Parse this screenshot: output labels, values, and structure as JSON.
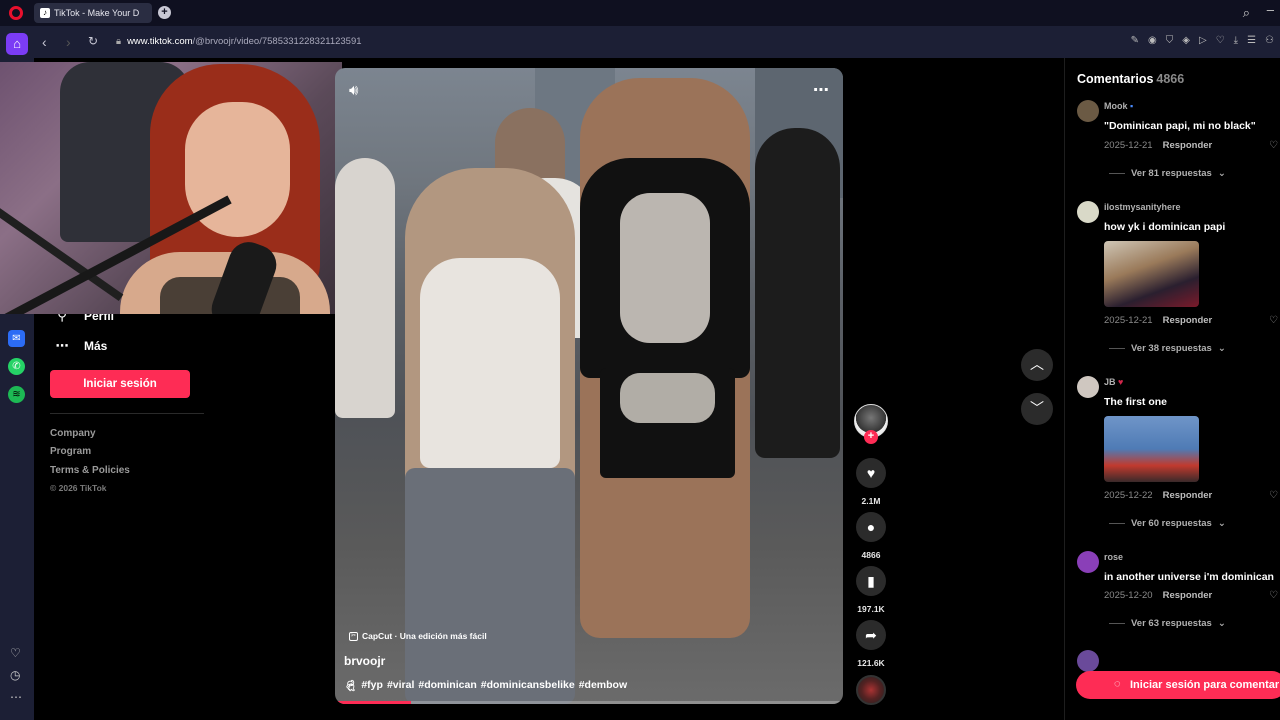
{
  "browser": {
    "tab_title": "TikTok - Make Your D",
    "url_host": "www.tiktok.com",
    "url_path": "/@brvoojr/video/7585331228321123591",
    "new_tab_symbol": "+"
  },
  "nav": {
    "items": [
      {
        "label": "Perfil",
        "icon": "person-icon"
      },
      {
        "label": "Más",
        "icon": "more-icon"
      }
    ],
    "login_label": "Iniciar sesión",
    "footer_links": [
      "Company",
      "Program",
      "Terms & Policies"
    ],
    "copyright": "© 2026 TikTok"
  },
  "video": {
    "capcut_label": "CapCut · Una edición más fácil",
    "author": "brvoojr",
    "tags": [
      "#fyp",
      "#viral",
      "#dominican",
      "#dominicansbelike",
      "#dembow"
    ],
    "progress": 0.15
  },
  "actions": [
    {
      "name": "like",
      "icon": "heart-icon",
      "count": "2.1M"
    },
    {
      "name": "comment",
      "icon": "comment-icon",
      "count": "4866"
    },
    {
      "name": "save",
      "icon": "bookmark-icon",
      "count": "197.1K"
    },
    {
      "name": "share",
      "icon": "share-icon",
      "count": "121.6K"
    }
  ],
  "comments": {
    "title": "Comentarios",
    "count": "4866",
    "reply_label": "Responder",
    "items": [
      {
        "user": "Mook",
        "text": "\"Dominican papi, mi no black\"",
        "date": "2025-12-21",
        "replies": "Ver 81 respuestas"
      },
      {
        "user": "ilostmysanityhere",
        "text": "how yk i dominican papi",
        "date": "2025-12-21",
        "replies": "Ver 38 respuestas"
      },
      {
        "user": "JB",
        "text": "The first one",
        "date": "2025-12-22",
        "replies": "Ver 60 respuestas"
      },
      {
        "user": "rose",
        "text": "in another universe i'm dominican",
        "date": "2025-12-20",
        "replies": "Ver 63 respuestas"
      }
    ],
    "login_label": "Iniciar sesión para comentar"
  },
  "colors": {
    "accent": "#fe2c55",
    "opera_purple": "#7b3cf5",
    "chrome_bg": "#1c1f35"
  }
}
